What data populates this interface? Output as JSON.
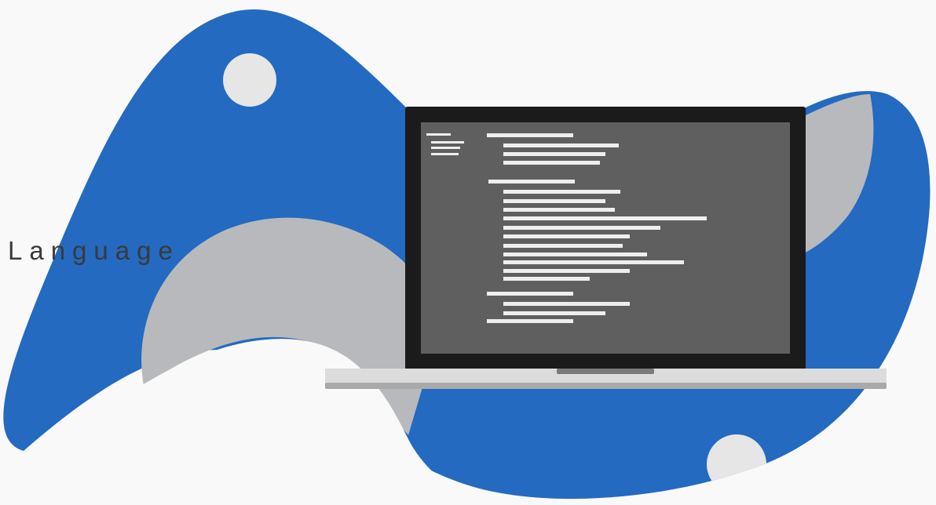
{
  "heading": {
    "text": "Language"
  },
  "colors": {
    "background": "#f9f9f9",
    "blob": "#236ac0",
    "shape_gray": "#b8b9bd",
    "circle": "#e6e6e6",
    "laptop_frame": "#1b1b1b",
    "screen": "#5f5f5f",
    "code_line": "#eeeeee",
    "laptop_base": "#dcdcdc"
  },
  "icons": {
    "device": "laptop-icon",
    "screen_content": "code-lines"
  }
}
